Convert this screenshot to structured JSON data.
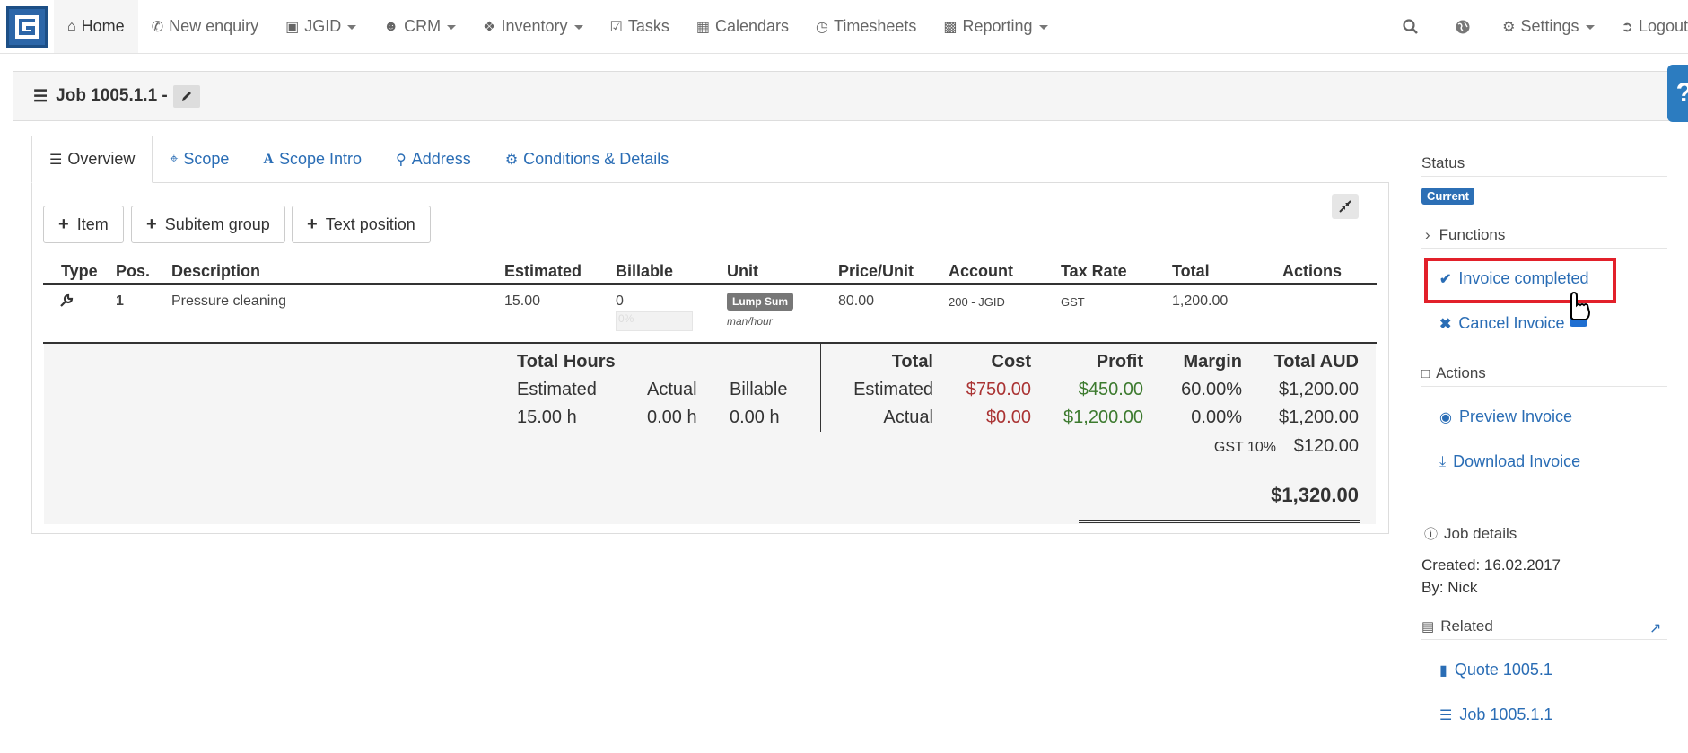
{
  "nav": {
    "home": "Home",
    "new_enquiry": "New enquiry",
    "jgid": "JGID",
    "crm": "CRM",
    "inventory": "Inventory",
    "tasks": "Tasks",
    "calendars": "Calendars",
    "timesheets": "Timesheets",
    "reporting": "Reporting",
    "settings": "Settings",
    "logout": "Logout"
  },
  "page": {
    "title": "Job 1005.1.1 -",
    "help": "?"
  },
  "tabs": [
    "Overview",
    "Scope",
    "Scope Intro",
    "Address",
    "Conditions & Details"
  ],
  "buttons": {
    "item": "Item",
    "subitem_group": "Subitem group",
    "text_position": "Text position"
  },
  "table": {
    "headers": [
      "Type",
      "Pos.",
      "Description",
      "Estimated",
      "Billable",
      "Unit",
      "Price/Unit",
      "Account",
      "Tax Rate",
      "Total",
      "Actions"
    ],
    "row": {
      "pos": "1",
      "description": "Pressure cleaning",
      "estimated": "15.00",
      "billable": "0",
      "billable_input": "0%",
      "unit_badge": "Lump Sum",
      "unit_sub": "man/hour",
      "price_unit": "80.00",
      "account": "200 - JGID",
      "tax_rate": "GST",
      "total": "1,200.00"
    }
  },
  "totals": {
    "hours_title": "Total Hours",
    "hours_labels": [
      "Estimated",
      "Actual",
      "Billable"
    ],
    "hours_values": [
      "15.00 h",
      "0.00 h",
      "0.00 h"
    ],
    "headers": [
      "Total",
      "Cost",
      "Profit",
      "Margin",
      "Total AUD"
    ],
    "estimated": {
      "label": "Estimated",
      "cost": "$750.00",
      "profit": "$450.00",
      "margin": "60.00%",
      "total": "$1,200.00"
    },
    "actual": {
      "label": "Actual",
      "cost": "$0.00",
      "profit": "$1,200.00",
      "margin": "0.00%",
      "total": "$1,200.00"
    },
    "gst_label": "GST 10%",
    "gst_value": "$120.00",
    "grand_total": "$1,320.00"
  },
  "sidebar": {
    "status_label": "Status",
    "status_badge": "Current",
    "functions_label": "Functions",
    "invoice_completed": "Invoice completed",
    "cancel_invoice": "Cancel Invoice",
    "actions_label": "Actions",
    "preview_invoice": "Preview Invoice",
    "download_invoice": "Download Invoice",
    "job_details_label": "Job details",
    "created": "Created: 16.02.2017",
    "by": "By: Nick",
    "related_label": "Related",
    "quote_link": "Quote 1005.1",
    "job_link": "Job 1005.1.1"
  },
  "colors": {
    "accent": "#2a6db5",
    "highlight": "#e2202a",
    "cost": "#aa3333",
    "profit": "#3c7a2e"
  }
}
